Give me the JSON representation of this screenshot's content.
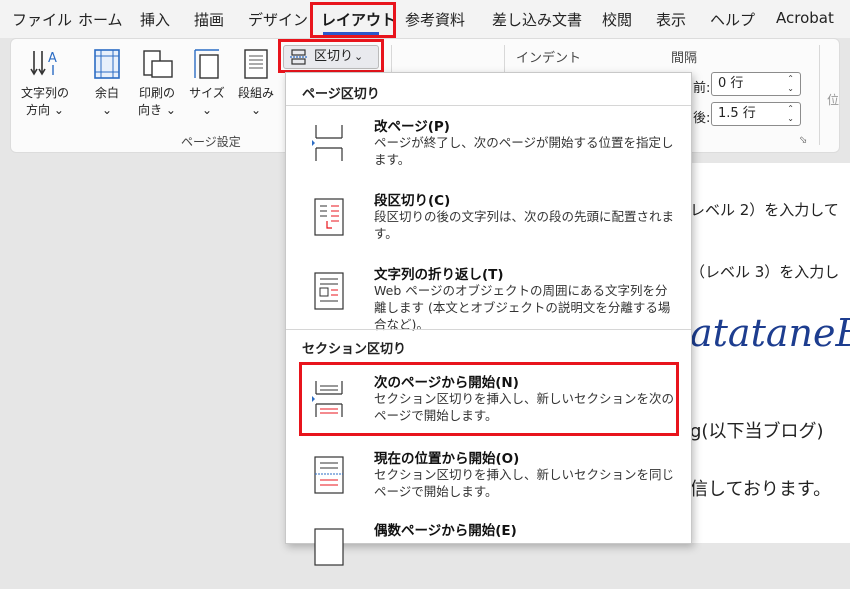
{
  "tabs": [
    "ファイル",
    "ホーム",
    "挿入",
    "描画",
    "デザイン",
    "レイアウト",
    "参考資料",
    "差し込み文書",
    "校閲",
    "表示",
    "ヘルプ",
    "Acrobat"
  ],
  "active_tab": "レイアウト",
  "ribbon": {
    "text_direction": [
      "文字列の",
      "方向"
    ],
    "margins": "余白",
    "orientation": [
      "印刷の",
      "向き"
    ],
    "size": "サイズ",
    "columns": "段組み",
    "breaks_button": "区切り",
    "page_setup_label": "ページ設定",
    "indent_label": "インデント",
    "spacing_label": "間隔",
    "before_label": "前:",
    "before_value": "0 行",
    "after_label": "後:",
    "after_value": "1.5 行",
    "cut_label": "位"
  },
  "dropdown": {
    "page_breaks_header": "ページ区切り",
    "section_breaks_header": "セクション区切り",
    "items": [
      {
        "title": "改ページ(P)",
        "desc": "ページが終了し、次のページが開始する位置を指定します。"
      },
      {
        "title": "段区切り(C)",
        "desc": "段区切りの後の文字列は、次の段の先頭に配置されます。"
      },
      {
        "title": "文字列の折り返し(T)",
        "desc": "Web ページのオブジェクトの周囲にある文字列を分離します (本文とオブジェクトの説明文を分離する場合など)。"
      },
      {
        "title": "次のページから開始(N)",
        "desc": "セクション区切りを挿入し、新しいセクションを次のページで開始します。"
      },
      {
        "title": "現在の位置から開始(O)",
        "desc": "セクション区切りを挿入し、新しいセクションを同じページで開始します。"
      },
      {
        "title": "偶数ページから開始(E)",
        "desc": ""
      }
    ]
  },
  "document": {
    "line1": "レベル 2）を入力して",
    "line2": "（レベル 3）を入力し",
    "heading": "atataneB",
    "line3": "g(以下当ブログ)",
    "line4": "信しております。"
  }
}
